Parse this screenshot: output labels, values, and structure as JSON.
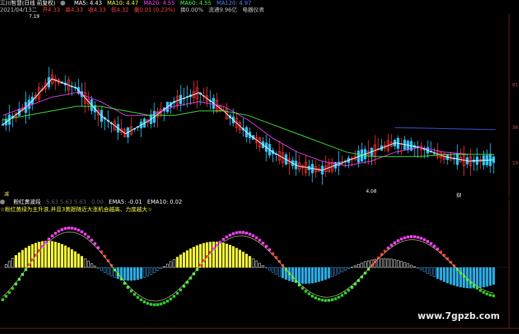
{
  "header": {
    "title": "三川智慧(日线 前复权)",
    "ma5_label": "MA5: 4.43",
    "ma10_label": "MA10: 4.47",
    "ma20_label": "MA20: 4.55",
    "ma60_label": "MA60: 4.55",
    "ma120_label": "MA120: 4.97"
  },
  "info": {
    "date": "2021/04/13二",
    "open": "开4.33",
    "high": "高4.33",
    "low": "收4.33",
    "close": "低4.32",
    "change": "量0.01 (0.23%)",
    "turnover": "换0.00%",
    "float": "流通9.96亿",
    "sector": "电器仪表"
  },
  "price_annotations": {
    "high": "7.19",
    "low": "4.08",
    "flag_left": "减",
    "flag_right": "财"
  },
  "price_axis": [
    "61",
    "38",
    "19"
  ],
  "sub": {
    "indicator_name": "粉红黄波段",
    "values": "5.63  5.63  5.63",
    "zero": "0.00",
    "ema5": "EMA5: -0.01",
    "ema10": "EMA10: 0.02",
    "note": "☆粉红黄绿为主升浪,并且3黄跟随近大涨机会越高、力度越大☆"
  },
  "watermark": "www.7gpzb.com",
  "colors": {
    "up": "#ff3030",
    "down": "#30c8ff",
    "ma5": "#ffffff",
    "ma10": "#ffff40",
    "ma20": "#ff40ff",
    "ma60": "#40ff40",
    "ma120": "#4060ff"
  },
  "chart_data": {
    "type": "line",
    "title": "三川智慧(日线 前复权)",
    "series": [
      {
        "name": "MA5",
        "values": [
          5.2,
          5.6,
          6.2,
          6.0,
          5.4,
          5.0,
          5.3,
          5.7,
          5.9,
          5.5,
          5.0,
          4.6,
          4.3,
          4.2,
          4.4,
          4.6,
          4.8,
          4.7,
          4.5,
          4.4,
          4.43
        ]
      },
      {
        "name": "MA20",
        "values": [
          5.4,
          5.6,
          5.8,
          5.9,
          5.7,
          5.4,
          5.4,
          5.6,
          5.7,
          5.6,
          5.3,
          4.9,
          4.6,
          4.4,
          4.3,
          4.4,
          4.6,
          4.7,
          4.6,
          4.55,
          4.55
        ]
      },
      {
        "name": "MA60",
        "values": [
          5.3,
          5.4,
          5.5,
          5.6,
          5.6,
          5.5,
          5.4,
          5.4,
          5.5,
          5.5,
          5.4,
          5.2,
          5.0,
          4.8,
          4.6,
          4.5,
          4.5,
          4.5,
          4.55,
          4.55,
          4.55
        ]
      }
    ],
    "annotations": [
      "7.19",
      "4.08"
    ]
  }
}
